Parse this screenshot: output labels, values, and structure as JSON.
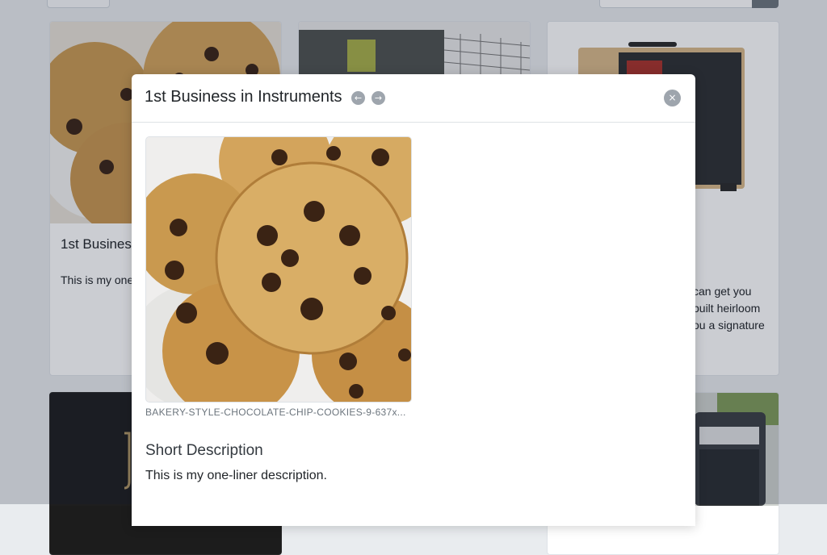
{
  "background": {
    "search": {
      "placeholder": ""
    },
    "cards": [
      {
        "title": "1st Business",
        "text": "This is my one"
      },
      {
        "title": "",
        "text": ""
      },
      {
        "title": "",
        "text": "can get you\nbuilt heirloom\nou a signature"
      }
    ]
  },
  "modal": {
    "title": "1st Business in Instruments",
    "prev_icon": "arrow-left-icon",
    "next_icon": "arrow-right-icon",
    "close_icon": "close-icon",
    "prev_glyph": "←",
    "next_glyph": "→",
    "close_glyph": "×",
    "image_caption": "BAKERY-STYLE-CHOCOLATE-CHIP-COOKIES-9-637x...",
    "section_heading": "Short Description",
    "section_text": "This is my one-liner description."
  },
  "colors": {
    "page_bg": "#e9ecef",
    "backdrop": "rgba(20,28,48,0.22)",
    "icon_button": "#9ea5ad",
    "muted_text": "#6c757d"
  }
}
